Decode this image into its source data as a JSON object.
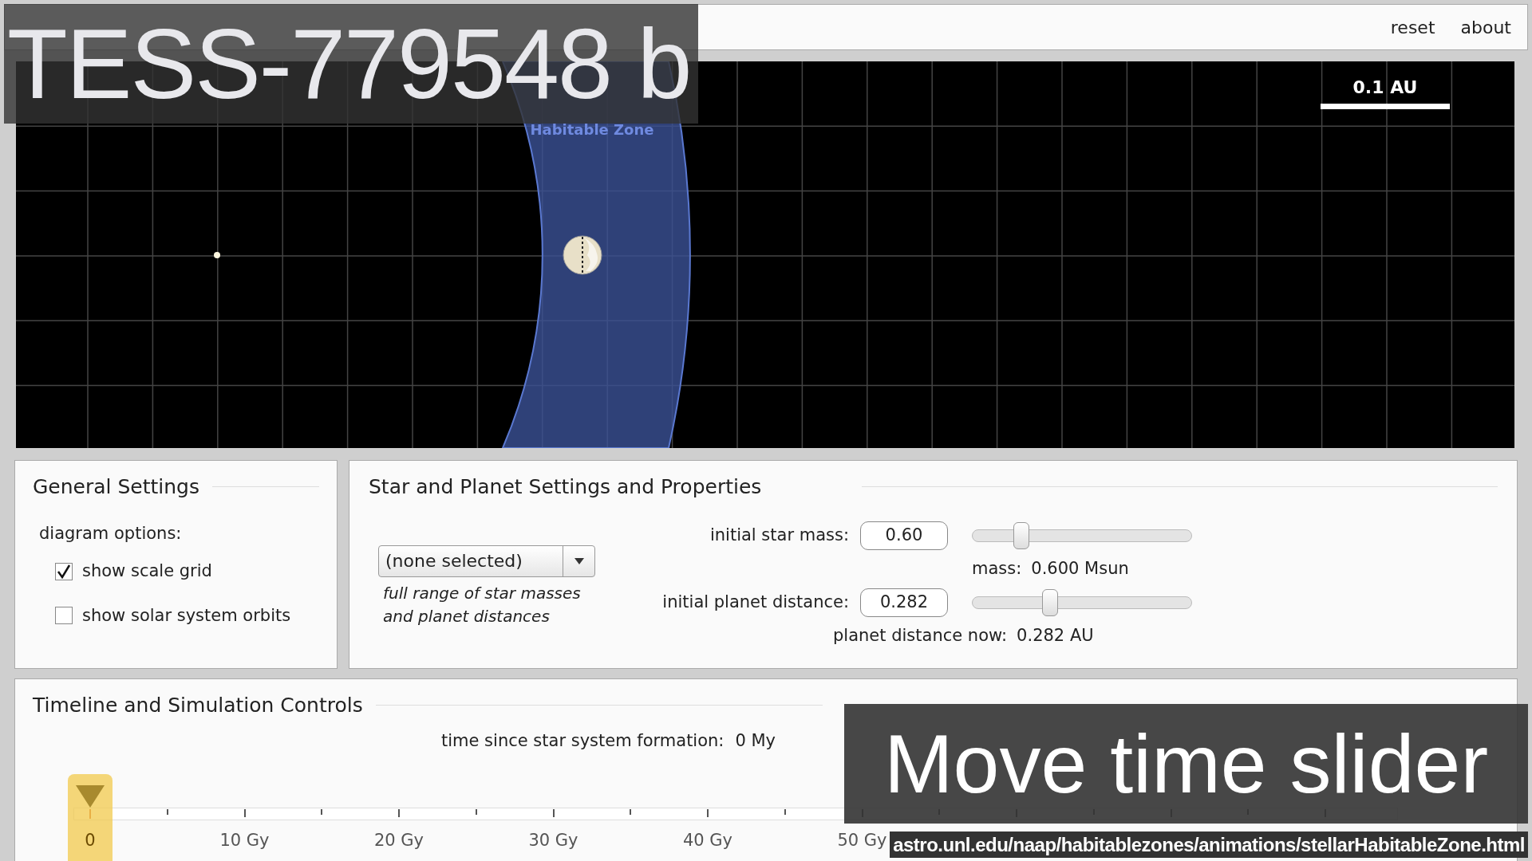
{
  "header": {
    "links": [
      "reset",
      "about"
    ]
  },
  "diagram": {
    "zone_label": "Habitable Zone",
    "scale_label": "0.1 AU"
  },
  "general_settings": {
    "title": "General Settings",
    "section_label": "diagram options:",
    "options": [
      {
        "label": "show scale grid",
        "checked": true
      },
      {
        "label": "show solar system orbits",
        "checked": false
      }
    ]
  },
  "star_planet": {
    "title": "Star and Planet Settings and Properties",
    "preset": "(none selected)",
    "preset_note": "full range of star masses and planet distances",
    "controls": [
      {
        "label": "initial star mass:",
        "value": "0.60",
        "level": 0.2,
        "reading_label": "mass:",
        "reading": "0.600 Msun"
      },
      {
        "label": "initial planet distance:",
        "value": "0.282",
        "level": 0.34,
        "reading_label": "planet distance now:",
        "reading": "0.282 AU"
      }
    ]
  },
  "timeline": {
    "title": "Timeline and Simulation Controls",
    "time_label": "time since star system formation:",
    "time_value": "0 My",
    "level": 0,
    "ticks": [
      "0",
      "10 Gy",
      "20 Gy",
      "30 Gy",
      "40 Gy",
      "50 Gy"
    ]
  },
  "overlays": {
    "heading": "TESS-779548 b",
    "caption": "Move time slider",
    "url": "astro.unl.edu/naap/habitablezones/animations/stellarHabitableZone.html"
  }
}
